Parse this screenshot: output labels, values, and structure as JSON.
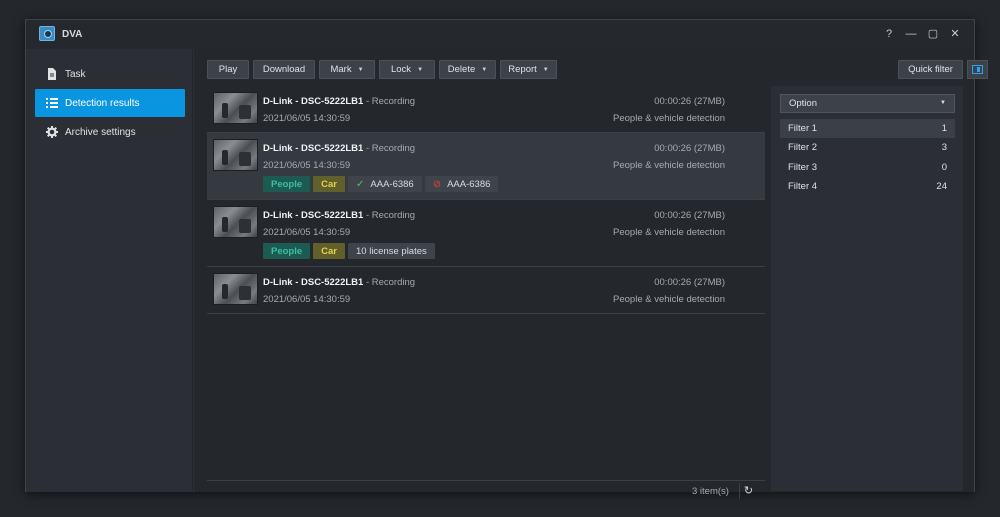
{
  "window": {
    "title": "DVA",
    "controls": [
      "?",
      "—",
      "▢",
      "✕"
    ]
  },
  "sidebar": {
    "items": [
      {
        "label": "Task",
        "icon": "document-icon",
        "active": false
      },
      {
        "label": "Detection results",
        "icon": "list-icon",
        "active": true
      },
      {
        "label": "Archive settings",
        "icon": "gear-icon",
        "active": false
      }
    ]
  },
  "toolbar": {
    "play": "Play",
    "download": "Download",
    "mark": "Mark",
    "lock": "Lock",
    "delete": "Delete",
    "report": "Report",
    "quick_filter": "Quick filter"
  },
  "results": [
    {
      "camera": "D-Link - DSC-5222LB1",
      "status": "- Recording",
      "date": "2021/06/05 14:30:59",
      "duration": "00:00:26 (27MB)",
      "detection": "People & vehicle detection",
      "selected": false,
      "tags": []
    },
    {
      "camera": "D-Link - DSC-5222LB1",
      "status": "- Recording",
      "date": "2021/06/05 14:30:59",
      "duration": "00:00:26 (27MB)",
      "detection": "People & vehicle detection",
      "selected": true,
      "tags": [
        {
          "type": "people",
          "label": "People"
        },
        {
          "type": "car",
          "label": "Car"
        },
        {
          "type": "plate-allowed",
          "label": "AAA-6386"
        },
        {
          "type": "plate-blocked",
          "label": "AAA-6386"
        }
      ]
    },
    {
      "camera": "D-Link - DSC-5222LB1",
      "status": "- Recording",
      "date": "2021/06/05 14:30:59",
      "duration": "00:00:26 (27MB)",
      "detection": "People & vehicle detection",
      "selected": false,
      "tags": [
        {
          "type": "people",
          "label": "People"
        },
        {
          "type": "car",
          "label": "Car"
        },
        {
          "type": "plates",
          "label": "10 license plates"
        }
      ]
    },
    {
      "camera": "D-Link - DSC-5222LB1",
      "status": "- Recording",
      "date": "2021/06/05 14:30:59",
      "duration": "00:00:26 (27MB)",
      "detection": "People & vehicle detection",
      "selected": false,
      "tags": []
    }
  ],
  "footer": {
    "count": "3 item(s)"
  },
  "filter_panel": {
    "option_label": "Option",
    "filters": [
      {
        "label": "Filter 1",
        "count": "1",
        "selected": true
      },
      {
        "label": "Filter 2",
        "count": "3",
        "selected": false
      },
      {
        "label": "Filter 3",
        "count": "0",
        "selected": false
      },
      {
        "label": "Filter 4",
        "count": "24",
        "selected": false
      }
    ]
  },
  "colors": {
    "accent": "#0a95e0",
    "people_tag": "#3bbfa6",
    "car_tag": "#e3d34a",
    "allowed": "#4cc46a",
    "blocked": "#e0453a"
  }
}
